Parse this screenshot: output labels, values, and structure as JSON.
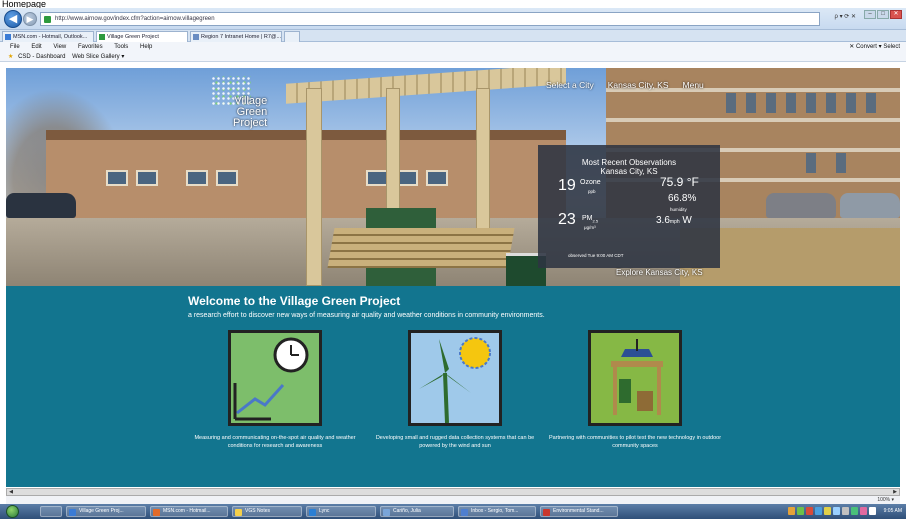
{
  "doc_title": "Homepage",
  "browser": {
    "address": "http://www.airnow.gov/index.cfm?action=airnow.villagegreen",
    "address_tools": "ρ ▾ ⟳  ✕",
    "tabs": [
      {
        "label": "MSN.com - Hotmail, Outlook..."
      },
      {
        "label": "Village Green Project"
      },
      {
        "label": "Region 7 Intranet Home | R7@..."
      }
    ],
    "menu": [
      "File",
      "Edit",
      "View",
      "Favorites",
      "Tools",
      "Help"
    ],
    "menu_right": "✕  Convert ▾  Select",
    "favorites": [
      "CSD - Dashboard",
      "Web Slice Gallery ▾"
    ]
  },
  "hero": {
    "logo_text": "Village\nGreen\nProject",
    "nav": [
      "Select a City",
      "Kansas City, KS",
      "Menu"
    ],
    "explore_link": "Explore Kansas City, KS"
  },
  "observations": {
    "title_line1": "Most Recent Observations",
    "title_line2": "Kansas City, KS",
    "ozone_value": "19",
    "ozone_label": "Ozone",
    "ozone_unit": "ppb",
    "pm_value": "23",
    "pm_label": "PM",
    "pm_sub": "2.5",
    "pm_unit": "μg/m³",
    "temperature": "75.9 °F",
    "humidity_value": "66.8%",
    "humidity_label": "humidity",
    "wind_value": "3.6",
    "wind_unit": "mph",
    "wind_dir": "W",
    "observed": "observed Tue 9:00 AM CDT"
  },
  "main": {
    "welcome_title": "Welcome to the Village Green Project",
    "welcome_sub": "a research effort to discover new ways of measuring air quality and weather conditions in community environments.",
    "features": [
      {
        "icon": "clock-chart-icon",
        "text": "Measuring and communicating on-the-spot air quality and weather conditions for research and awareness"
      },
      {
        "icon": "wind-sun-icon",
        "text": "Developing small and rugged data collection systems that can be powered by the wind and sun"
      },
      {
        "icon": "monitoring-station-icon",
        "text": "Partnering with communities to pilot test the new technology in outdoor community spaces"
      }
    ]
  },
  "status": {
    "zoom": "100% ▾"
  },
  "taskbar": {
    "items": [
      "Village Green Proj...",
      "MSN.com - Hotmail...",
      "VGS Notes",
      "Lync",
      "Cariño, Julia",
      "Inbox - Sergio, Tom...",
      "Environmental Stand..."
    ],
    "clock": "9:05 AM"
  },
  "colors": {
    "teal": "#12758f",
    "panel": "#2d3442"
  }
}
